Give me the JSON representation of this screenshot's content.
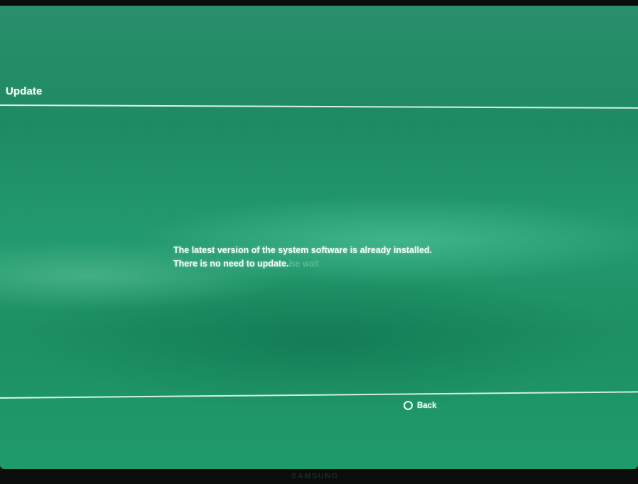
{
  "header": {
    "title": "Update"
  },
  "message": {
    "line1": "The latest version of the system software is already installed.",
    "line2": "There is no need to update.",
    "ghost_text": "ise wait."
  },
  "footer": {
    "back_label": "Back",
    "back_icon": "circle-button-icon"
  },
  "tv": {
    "brand": "SAMSUNG"
  },
  "colors": {
    "screen_background": "#1f9468",
    "text": "#f4fff9",
    "rule": "#ebfff5"
  }
}
